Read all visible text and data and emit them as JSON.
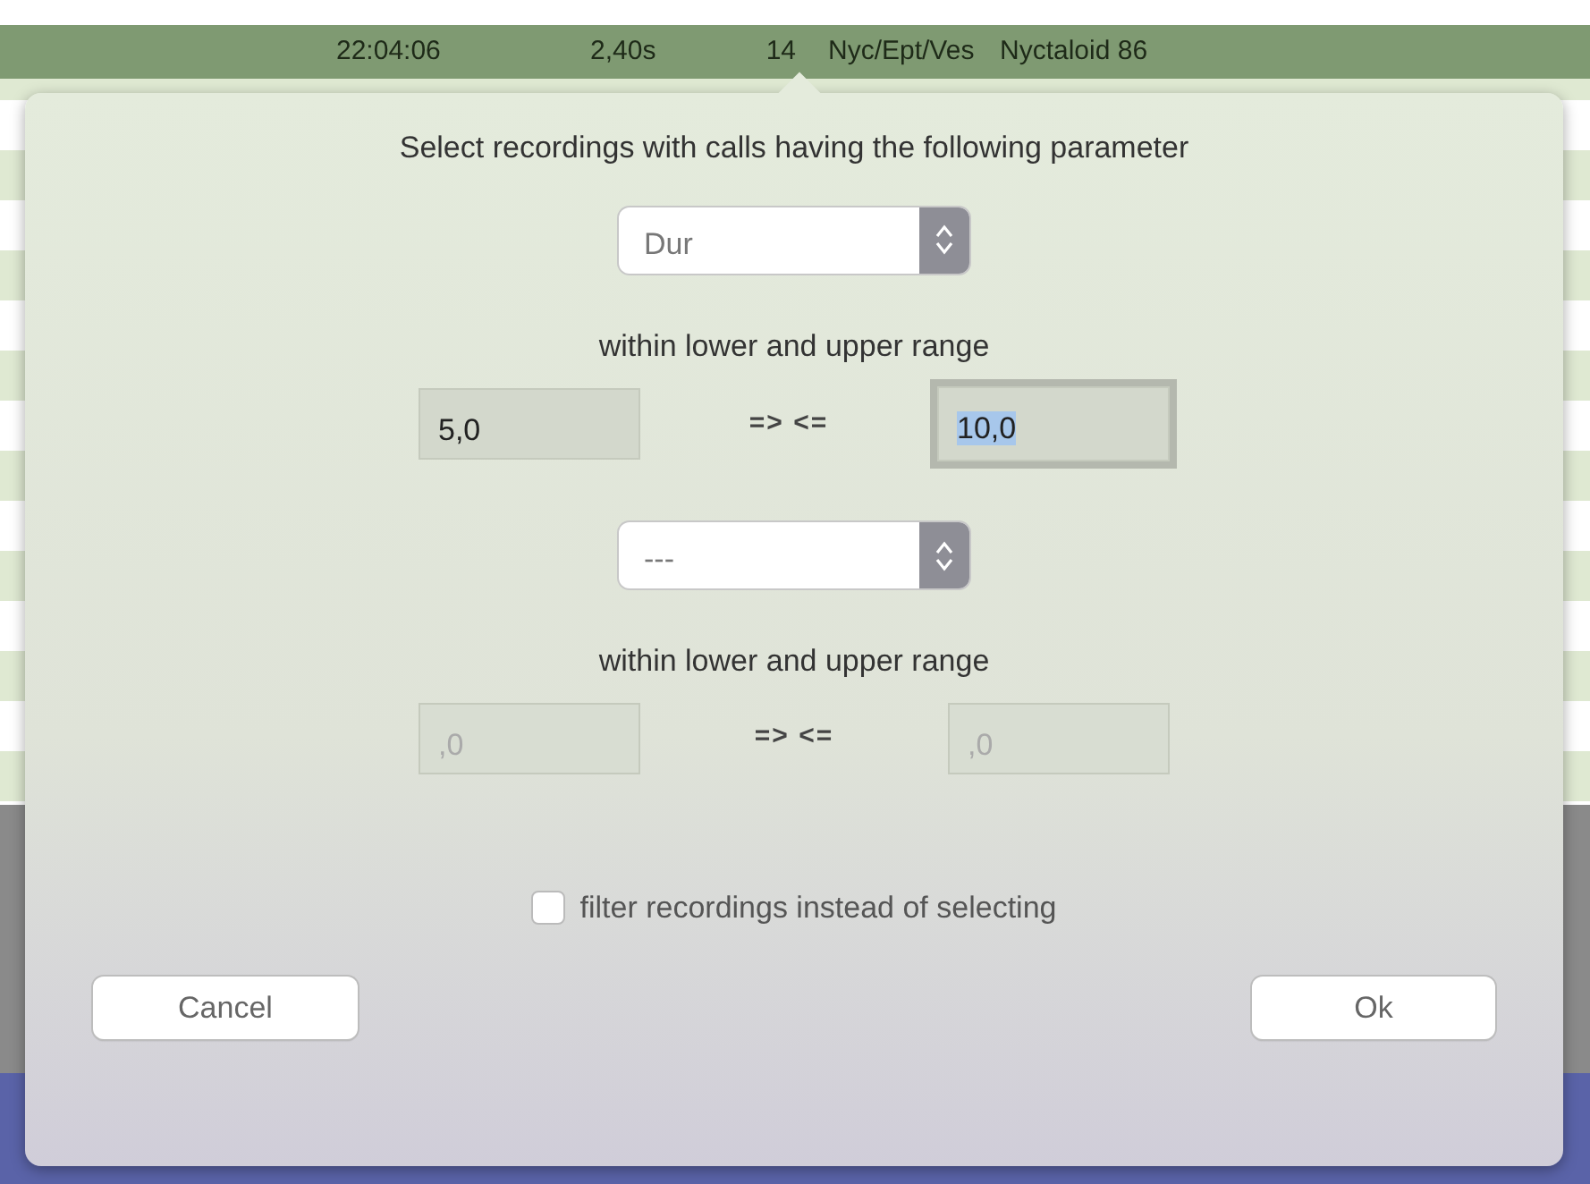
{
  "table_row": {
    "selected": true,
    "cells": [
      "22:04:06",
      "2,40s",
      "14",
      "Nyc/Ept/Ves",
      "Nyctaloid 86"
    ]
  },
  "dialog": {
    "prompt": "Select recordings with calls having the following parameter",
    "filters": [
      {
        "parameter": "Dur",
        "range_label": "within lower and upper range",
        "lower": {
          "value": "5,0",
          "focused": false
        },
        "operator": "=> <=",
        "upper": {
          "value": "10,0",
          "focused": true
        },
        "disabled": false
      },
      {
        "parameter": "---",
        "range_label": "within lower and upper range",
        "lower": {
          "value": ",0",
          "focused": false
        },
        "operator": "=> <=",
        "upper": {
          "value": ",0",
          "focused": false
        },
        "disabled": true
      }
    ],
    "checkbox": {
      "label": "filter recordings instead of selecting",
      "checked": false
    },
    "buttons": [
      "Cancel",
      "Ok"
    ]
  }
}
